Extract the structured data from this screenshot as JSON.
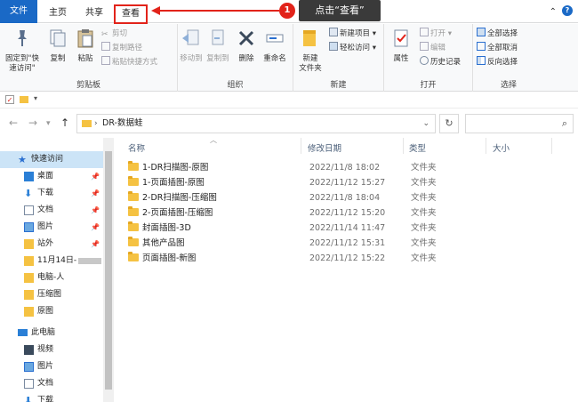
{
  "ribbon_tabs": {
    "file": "文件",
    "home": "主页",
    "share": "共享",
    "view": "查看"
  },
  "callout": {
    "step": "1",
    "text": "点击“查看”"
  },
  "clipboard": {
    "pin_label": "固定到\"快速访问\"",
    "copy_label": "复制",
    "paste_label": "粘贴",
    "cut_label": "剪切",
    "copy_path_label": "复制路径",
    "paste_shortcut_label": "粘贴快捷方式",
    "group_label": "剪贴板"
  },
  "organize": {
    "move_to": "移动到",
    "copy_to": "复制到",
    "delete": "删除",
    "rename": "重命名",
    "group_label": "组织"
  },
  "new_group": {
    "new_folder": "新建\n文件夹",
    "new_item": "新建项目",
    "easy_access": "轻松访问",
    "group_label": "新建"
  },
  "open_group": {
    "properties": "属性",
    "open": "打开",
    "edit": "编辑",
    "history": "历史记录",
    "group_label": "打开"
  },
  "select_group": {
    "select_all": "全部选择",
    "select_none": "全部取消",
    "invert": "反向选择",
    "group_label": "选择"
  },
  "address": {
    "path": "DR-数据蛙"
  },
  "sidebar": {
    "quick_access": "快速访问",
    "items": [
      {
        "label": "桌面",
        "pinned": true,
        "icon": "desktop-icon"
      },
      {
        "label": "下载",
        "pinned": true,
        "icon": "download-icon"
      },
      {
        "label": "文档",
        "pinned": true,
        "icon": "document-icon"
      },
      {
        "label": "图片",
        "pinned": true,
        "icon": "picture-icon"
      },
      {
        "label": "站外",
        "pinned": true,
        "icon": "folder-icon"
      },
      {
        "label": "11月14日-",
        "pinned": false,
        "icon": "folder-icon"
      },
      {
        "label": "电脑-人",
        "pinned": false,
        "icon": "folder-icon"
      },
      {
        "label": "压缩图",
        "pinned": false,
        "icon": "folder-icon"
      },
      {
        "label": "原图",
        "pinned": false,
        "icon": "folder-icon"
      }
    ],
    "this_pc": "此电脑",
    "pc_items": [
      {
        "label": "视频",
        "icon": "video-icon"
      },
      {
        "label": "图片",
        "icon": "picture-icon"
      },
      {
        "label": "文档",
        "icon": "document-icon"
      },
      {
        "label": "下载",
        "icon": "download-icon"
      }
    ]
  },
  "columns": {
    "name": "名称",
    "modified": "修改日期",
    "type": "类型",
    "size": "大小"
  },
  "files": [
    {
      "name": "1-DR扫描图-原图",
      "modified": "2022/11/8 18:02",
      "type": "文件夹"
    },
    {
      "name": "1-页面插图-原图",
      "modified": "2022/11/12 15:27",
      "type": "文件夹"
    },
    {
      "name": "2-DR扫描图-压缩图",
      "modified": "2022/11/8 18:04",
      "type": "文件夹"
    },
    {
      "name": "2-页面插图-压缩图",
      "modified": "2022/11/12 15:20",
      "type": "文件夹"
    },
    {
      "name": "封面插图-3D",
      "modified": "2022/11/14 11:47",
      "type": "文件夹"
    },
    {
      "name": "其他产品图",
      "modified": "2022/11/12 15:31",
      "type": "文件夹"
    },
    {
      "name": "页面插图-新图",
      "modified": "2022/11/12 15:22",
      "type": "文件夹"
    }
  ]
}
